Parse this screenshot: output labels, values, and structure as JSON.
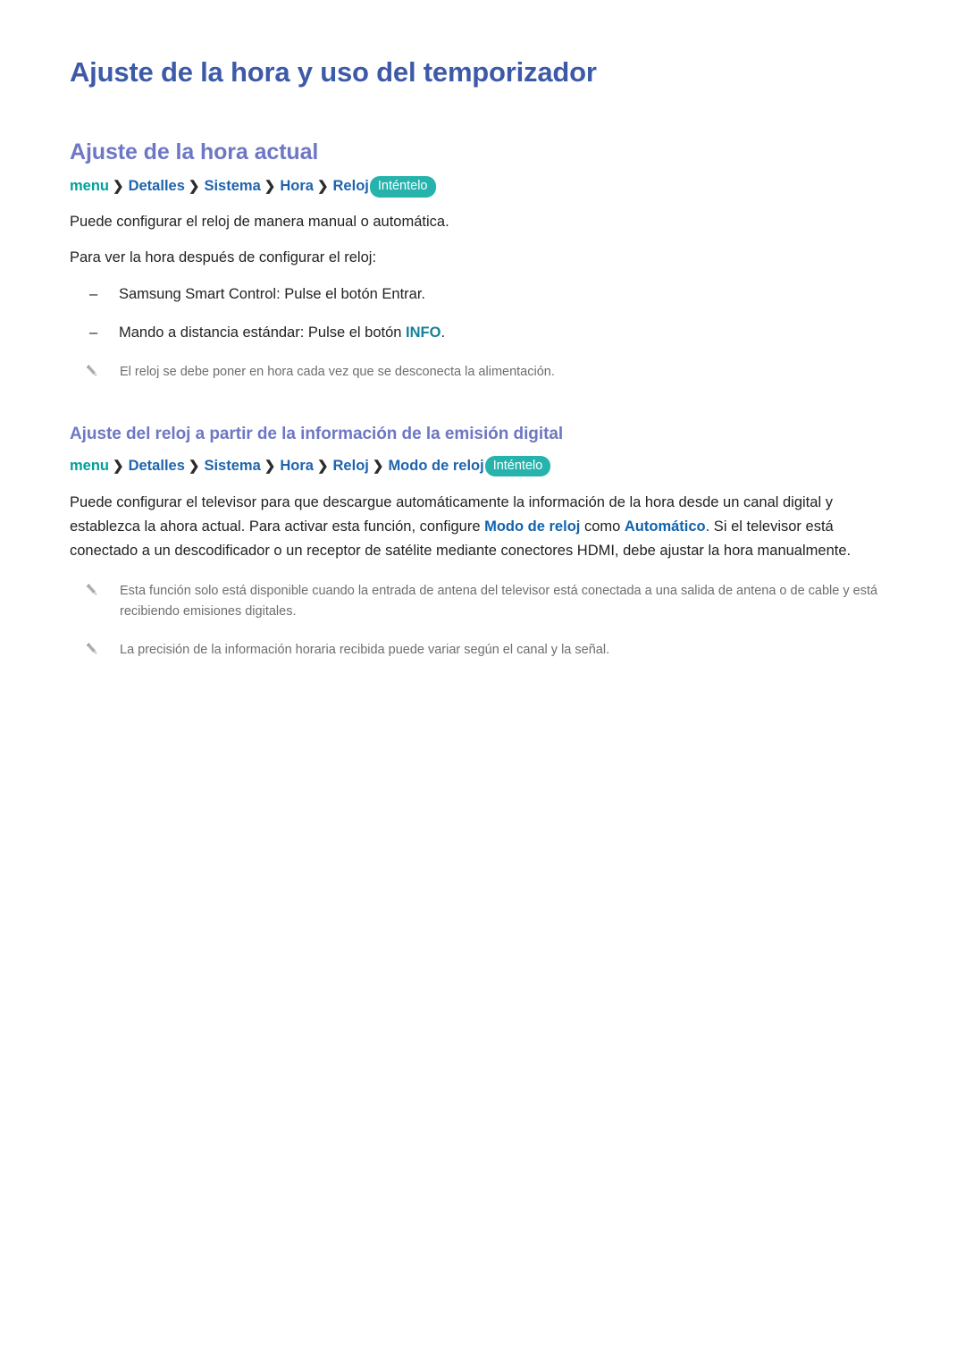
{
  "document": {
    "title": "Ajuste de la hora y uso del temporizador"
  },
  "sections": [
    {
      "heading": "Ajuste de la hora actual",
      "breadcrumb": {
        "root": "menu",
        "separator": "❯",
        "items": [
          "Detalles",
          "Sistema",
          "Hora",
          "Reloj"
        ],
        "badge": "Inténtelo"
      },
      "paragraphs": [
        "Puede configurar el reloj de manera manual o automática.",
        "Para ver la hora después de configurar el reloj:"
      ],
      "dash_list": [
        {
          "dash": "–",
          "text_before": "Samsung Smart Control: Pulse el botón Entrar.",
          "highlight": "",
          "text_after": ""
        },
        {
          "dash": "–",
          "text_before": "Mando a distancia estándar: Pulse el botón ",
          "highlight": "INFO",
          "text_after": "."
        }
      ],
      "notes": [
        "El reloj se debe poner en hora cada vez que se desconecta la alimentación."
      ]
    },
    {
      "heading": "Ajuste del reloj a partir de la información de la emisión digital",
      "breadcrumb": {
        "root": "menu",
        "separator": "❯",
        "items": [
          "Detalles",
          "Sistema",
          "Hora",
          "Reloj",
          "Modo de reloj"
        ],
        "badge": "Inténtelo"
      },
      "body": {
        "part1": "Puede configurar el televisor para que descargue automáticamente la información de la hora desde un canal digital y establezca la ahora actual. Para activar esta función, configure ",
        "bold1": "Modo de reloj",
        "part2": " como ",
        "bold2": "Automático",
        "part3": ". Si el televisor está conectado a un descodificador o un receptor de satélite mediante conectores HDMI, debe ajustar la hora manualmente."
      },
      "notes": [
        "Esta función solo está disponible cuando la entrada de antena del televisor está conectada a una salida de antena o de cable y está recibiendo emisiones digitales.",
        "La precisión de la información horaria recibida puede variar según el canal y la señal."
      ]
    }
  ],
  "icons": {
    "pencil": "pencil-icon"
  },
  "colors": {
    "page_title": "#3d5aa8",
    "section_title": "#6e77c4",
    "crumb_menu": "#00a09b",
    "crumb": "#1e63ad",
    "badge_bg": "#26b3ac",
    "bold_blue": "#1163ae",
    "bold_teal": "#15809b",
    "note_text": "#6d6e71"
  }
}
